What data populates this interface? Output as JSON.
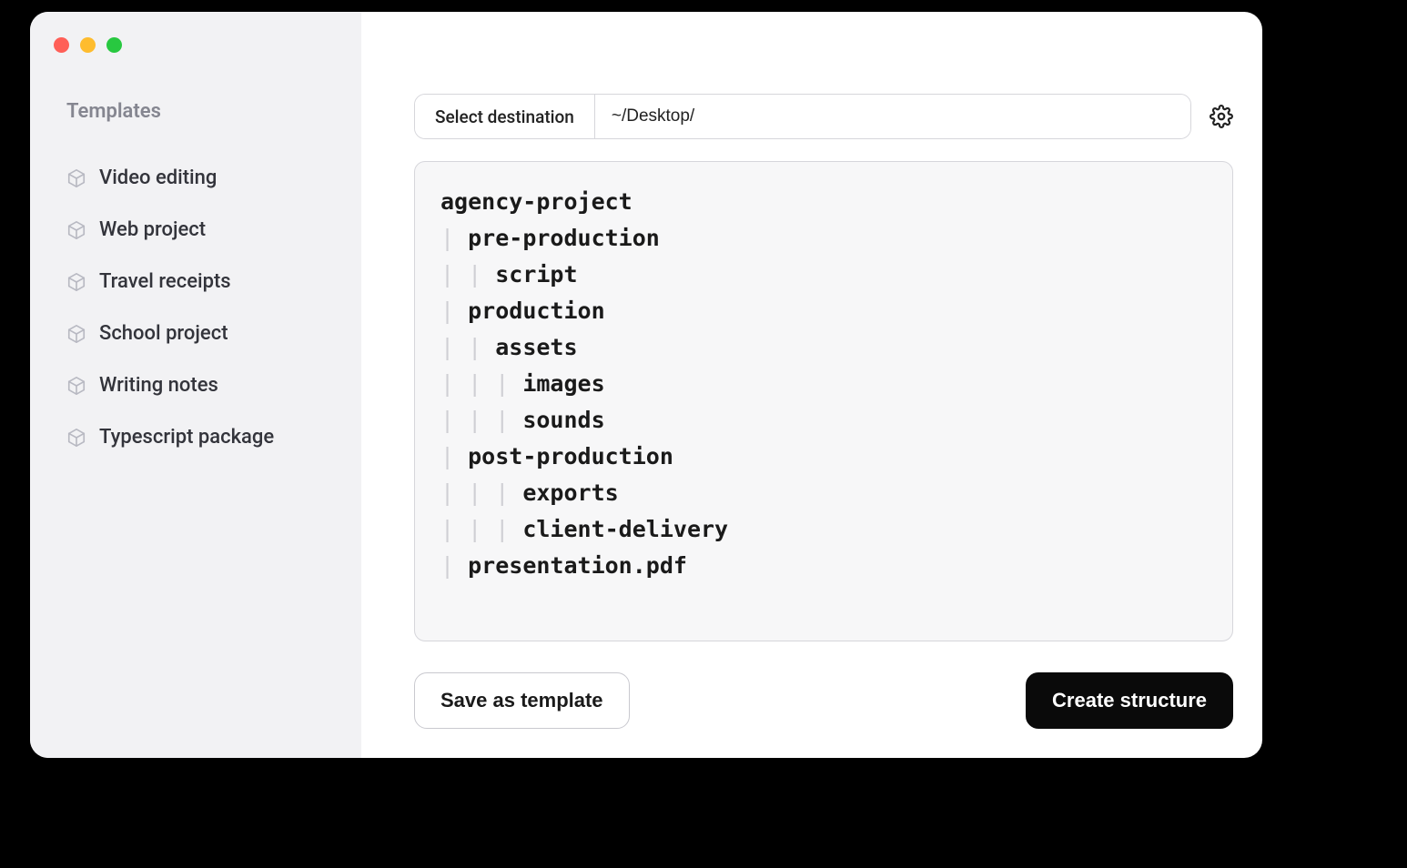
{
  "sidebar": {
    "title": "Templates",
    "items": [
      {
        "label": "Video editing"
      },
      {
        "label": "Web project"
      },
      {
        "label": "Travel receipts"
      },
      {
        "label": "School project"
      },
      {
        "label": "Writing notes"
      },
      {
        "label": "Typescript package"
      }
    ]
  },
  "destination": {
    "button_label": "Select destination",
    "path": "~/Desktop/"
  },
  "structure": {
    "lines": [
      {
        "depth": 0,
        "name": "agency-project"
      },
      {
        "depth": 1,
        "name": "pre-production"
      },
      {
        "depth": 2,
        "name": "script"
      },
      {
        "depth": 1,
        "name": "production"
      },
      {
        "depth": 2,
        "name": "assets"
      },
      {
        "depth": 3,
        "name": "images"
      },
      {
        "depth": 3,
        "name": "sounds"
      },
      {
        "depth": 1,
        "name": "post-production"
      },
      {
        "depth": 3,
        "name": "exports"
      },
      {
        "depth": 3,
        "name": "client-delivery"
      },
      {
        "depth": 1,
        "name": "presentation.pdf"
      }
    ]
  },
  "buttons": {
    "save_template": "Save as template",
    "create_structure": "Create structure"
  }
}
